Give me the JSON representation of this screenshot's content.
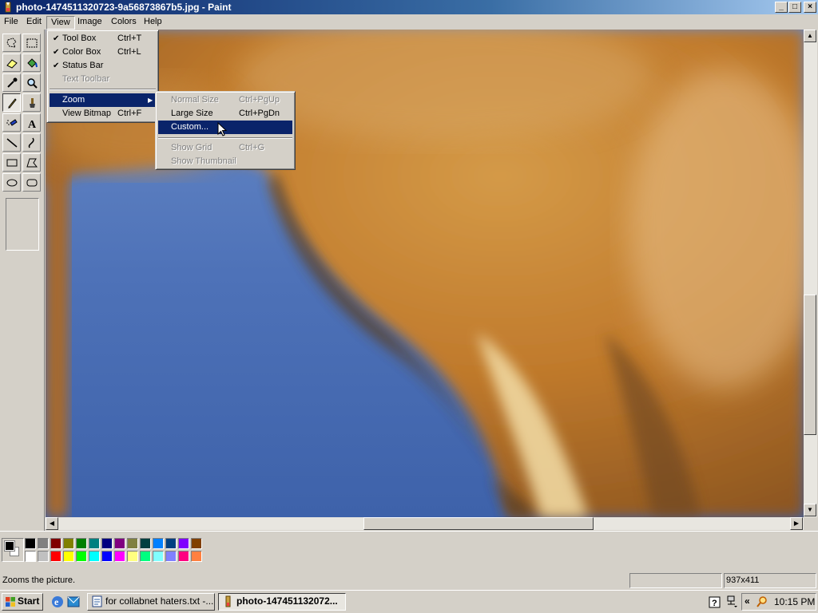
{
  "window": {
    "title": "photo-1474511320723-9a56873867b5.jpg - Paint",
    "buttons": {
      "minimize": "_",
      "maximize": "□",
      "close": "×"
    }
  },
  "menubar": {
    "items": [
      "File",
      "Edit",
      "View",
      "Image",
      "Colors",
      "Help"
    ],
    "open_menu": "View"
  },
  "view_menu": {
    "items": [
      {
        "label": "Tool Box",
        "shortcut": "Ctrl+T",
        "checked": true,
        "enabled": true
      },
      {
        "label": "Color Box",
        "shortcut": "Ctrl+L",
        "checked": true,
        "enabled": true
      },
      {
        "label": "Status Bar",
        "shortcut": "",
        "checked": true,
        "enabled": true
      },
      {
        "label": "Text Toolbar",
        "shortcut": "",
        "checked": false,
        "enabled": false
      },
      {
        "label": "Zoom",
        "shortcut": "",
        "submenu": true,
        "highlighted": true,
        "enabled": true
      },
      {
        "label": "View Bitmap",
        "shortcut": "Ctrl+F",
        "enabled": true
      }
    ]
  },
  "zoom_menu": {
    "items": [
      {
        "label": "Normal Size",
        "shortcut": "Ctrl+PgUp",
        "enabled": false
      },
      {
        "label": "Large Size",
        "shortcut": "Ctrl+PgDn",
        "enabled": true
      },
      {
        "label": "Custom...",
        "shortcut": "",
        "enabled": true,
        "highlighted": true
      },
      {
        "label": "Show Grid",
        "shortcut": "Ctrl+G",
        "enabled": false
      },
      {
        "label": "Show Thumbnail",
        "shortcut": "",
        "enabled": false
      }
    ]
  },
  "toolbox": {
    "tools": [
      "free-form-select",
      "select",
      "eraser",
      "fill-with-color",
      "pick-color",
      "magnifier",
      "pencil",
      "brush",
      "airbrush",
      "text",
      "line",
      "curve",
      "rectangle",
      "polygon",
      "ellipse",
      "rounded-rectangle"
    ],
    "active_tool": "pencil"
  },
  "colorbox": {
    "foreground": "#000000",
    "background": "#ffffff",
    "palette_row1": [
      "#000000",
      "#808080",
      "#800000",
      "#808000",
      "#008000",
      "#008080",
      "#000080",
      "#800080",
      "#808040",
      "#004040",
      "#0080ff",
      "#004080",
      "#8000ff",
      "#804000"
    ],
    "palette_row2": [
      "#ffffff",
      "#c0c0c0",
      "#ff0000",
      "#ffff00",
      "#00ff00",
      "#00ffff",
      "#0000ff",
      "#ff00ff",
      "#ffff80",
      "#00ff80",
      "#80ffff",
      "#8080ff",
      "#ff0080",
      "#ff8040"
    ]
  },
  "statusbar": {
    "message": "Zooms the picture.",
    "position": "",
    "size": "937x411"
  },
  "taskbar": {
    "start_label": "Start",
    "tasks": [
      {
        "label": "for collabnet haters.txt -...",
        "active": false
      },
      {
        "label": "photo-147451132072...",
        "active": true
      }
    ],
    "clock": "10:15 PM",
    "tray_chevron": "«"
  }
}
